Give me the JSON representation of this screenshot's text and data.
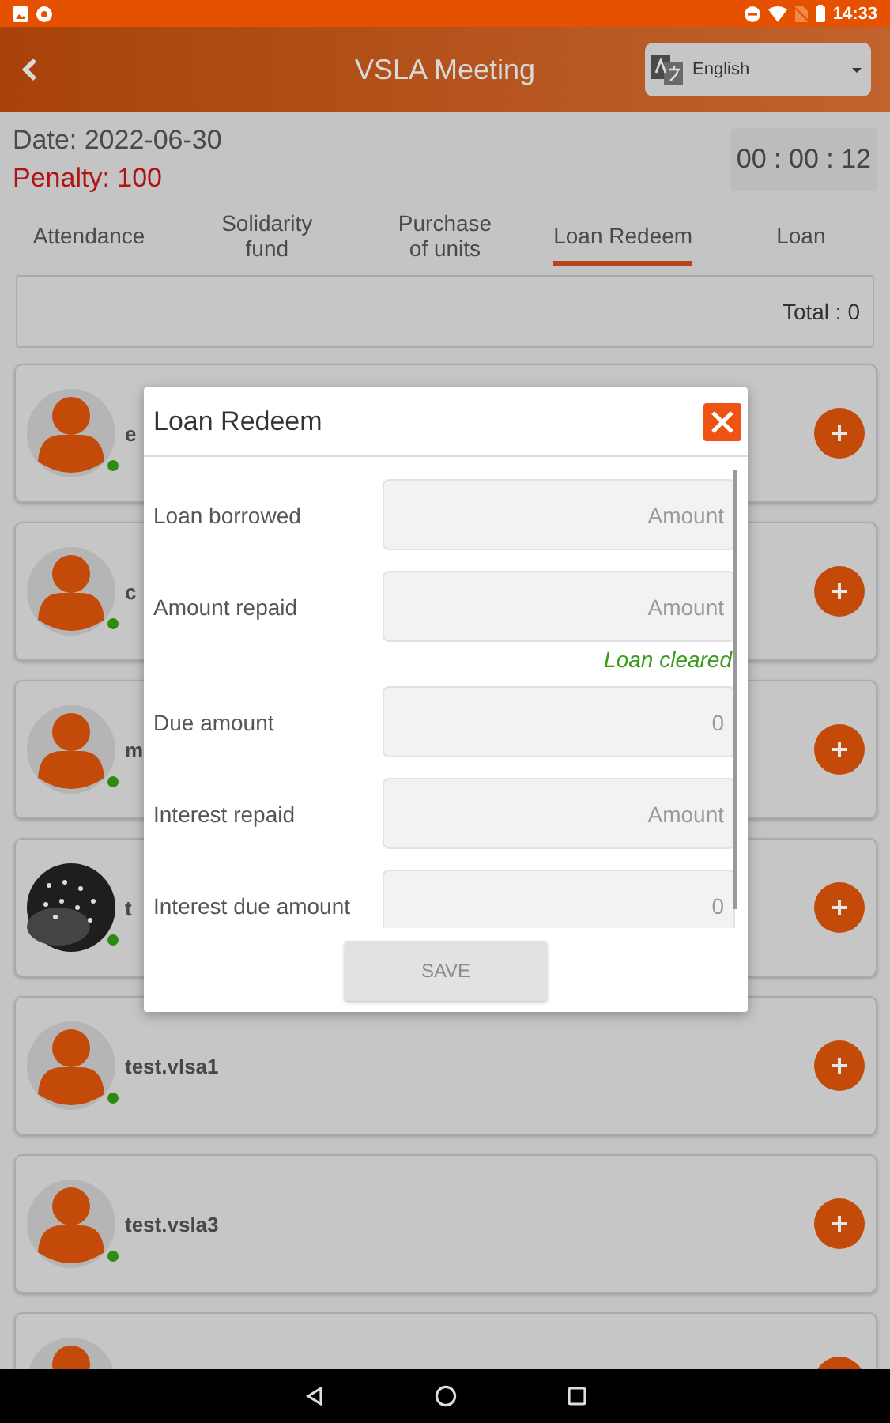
{
  "status_bar": {
    "time": "14:33"
  },
  "app_bar": {
    "title": "VSLA Meeting",
    "language": "English"
  },
  "meeting": {
    "date": "Date: 2022-06-30",
    "penalty": "Penalty: 100",
    "timer": "00 : 00 : 12"
  },
  "tabs": [
    {
      "label": "Attendance",
      "selected": false
    },
    {
      "label": "Solidarity fund",
      "selected": false
    },
    {
      "label": "Purchase of units",
      "selected": false
    },
    {
      "label": "Loan Redeem",
      "selected": true
    },
    {
      "label": "Loan",
      "selected": false
    }
  ],
  "total": "Total : 0",
  "members": [
    {
      "name": "e",
      "kind": "person",
      "online": true
    },
    {
      "name": "c",
      "kind": "person",
      "online": true
    },
    {
      "name": "m",
      "kind": "person",
      "online": true
    },
    {
      "name": "t",
      "online": true
    },
    {
      "name": "test.vlsa1",
      "kind": "person",
      "online": true
    },
    {
      "name": "test.vsla3",
      "kind": "person",
      "online": true
    },
    {
      "kind": "person"
    }
  ],
  "dialog": {
    "title": "Loan Redeem",
    "fields": [
      {
        "label": "Loan borrowed",
        "placeholder": "Amount"
      },
      {
        "label": "Amount repaid",
        "placeholder": "Amount",
        "note": "Loan cleared"
      },
      {
        "label": "Due amount",
        "placeholder": "0"
      },
      {
        "label": "Interest repaid",
        "placeholder": "Amount"
      },
      {
        "label": "Interest due amount",
        "placeholder": "0"
      }
    ],
    "save": {
      "label": "SAVE",
      "disabled": true
    }
  }
}
